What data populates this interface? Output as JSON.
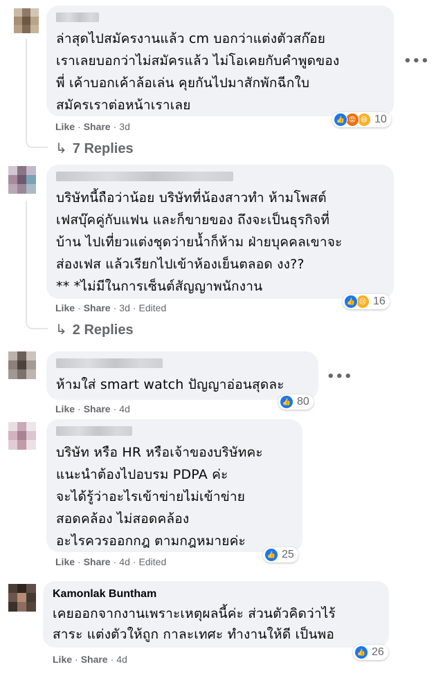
{
  "comments": [
    {
      "author": "",
      "lines": [
        "ล่าสุดไปสมัครงานแล้ว cm บอกว่าแต่งตัวสก๊อย",
        "เราเลยบอกว่าไม่สมัครแล้ว ไม่โอเคยกับคำพูดของ",
        "พี่ เค้าบอกเค้าล้อเล่น คุยกันไปมาสักพักฉีกใบ",
        "สมัครเราต่อหน้าเราเลย"
      ],
      "like": "Like",
      "share": "Share",
      "time": "3d",
      "edited": "",
      "reactions": [
        "like",
        "angry",
        "haha"
      ],
      "reaction_count": "10",
      "replies": "7 Replies"
    },
    {
      "author": "",
      "lines": [
        "บริษัทนี้ถือว่าน้อย บริษัทที่น้องสาวทำ ห้ามโพสต์",
        "เฟสบุ๊คคู่กับแฟน และก็ขายของ ถึงจะเป็นธุรกิจที่",
        "บ้าน ไปเที่ยวแต่งชุดว่ายน้ำก็ห้าม ฝ่ายบุคคลเขาจะ",
        "ส่องเฟส แล้วเรียกไปเข้าห้องเย็นตลอด งง??",
        "** *ไม่มีในการเซ็นต์สัญญาพนักงาน"
      ],
      "like": "Like",
      "share": "Share",
      "time": "3d",
      "edited": "Edited",
      "reactions": [
        "like",
        "sad"
      ],
      "reaction_count": "16",
      "replies": "2 Replies"
    },
    {
      "author": "",
      "lines": [
        "ห้ามใส่ smart watch ปัญญาอ่อนสุดละ"
      ],
      "like": "Like",
      "share": "Share",
      "time": "4d",
      "edited": "",
      "reactions": [
        "like"
      ],
      "reaction_count": "80",
      "replies": ""
    },
    {
      "author": "",
      "lines": [
        "บริษัท หรือ HR หรือเจ้าของบริษัทคะ",
        "แนะนำต้องไปอบรม PDPA ค่ะ",
        "จะได้รู้ว่าอะไรเข้าข่ายไม่เข้าข่าย",
        "สอดคล้อง ไม่สอดคล้อง",
        "อะไรควรออกกฎ ตามกฎหมายค่ะ"
      ],
      "like": "Like",
      "share": "Share",
      "time": "4d",
      "edited": "Edited",
      "reactions": [
        "like"
      ],
      "reaction_count": "25",
      "replies": ""
    },
    {
      "author": "Kamonlak Buntham",
      "lines": [
        "เคยออกจากงานเพราะเหตุผลนี้ค่ะ ส่วนตัวคิดว่าไร้",
        "สาระ แต่งตัวให้ถูก กาละเทศะ ทำงานให้ดี เป็นพอ"
      ],
      "like": "Like",
      "share": "Share",
      "time": "4d",
      "edited": "",
      "reactions": [
        "like"
      ],
      "reaction_count": "26",
      "replies": ""
    }
  ],
  "icons": {
    "like": "thumbs-up-icon",
    "angry": "angry-face-icon",
    "haha": "laughing-face-icon",
    "sad": "sad-face-icon",
    "more": "more-options-icon",
    "reply": "reply-arrow-icon"
  },
  "colors": {
    "bubble": "#f0f2f5",
    "like": "#1877f2",
    "muted": "#65676b"
  }
}
